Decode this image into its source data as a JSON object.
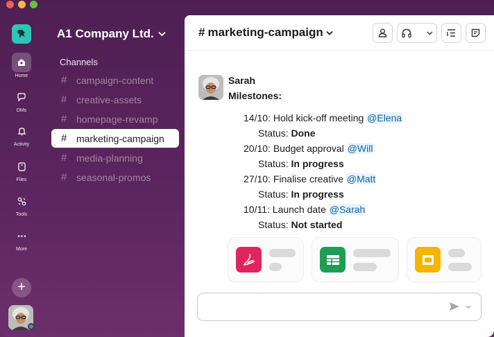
{
  "window": {
    "title": "Slack"
  },
  "rail": {
    "items": [
      {
        "label": "Home",
        "icon": "home-icon"
      },
      {
        "label": "DMs",
        "icon": "dms-icon"
      },
      {
        "label": "Activity",
        "icon": "bell-icon"
      },
      {
        "label": "Files",
        "icon": "files-icon"
      },
      {
        "label": "Tools",
        "icon": "tools-icon"
      },
      {
        "label": "More",
        "icon": "more-icon"
      }
    ],
    "add_label": "+"
  },
  "sidebar": {
    "workspace": "A1 Company Ltd.",
    "section": "Channels",
    "channels": [
      "campaign-content",
      "creative-assets",
      "homepage-revamp",
      "marketing-campaign",
      "media-planning",
      "seasonal-promos"
    ],
    "active_channel_index": 3
  },
  "header": {
    "channel": "marketing-campaign",
    "hash": "#"
  },
  "message": {
    "author": "Sarah",
    "title": "Milestones:",
    "items": [
      {
        "date": "14/10:",
        "text": "Hold kick-off meeting",
        "mention": "@Elena",
        "status_label": "Status:",
        "status": "Done"
      },
      {
        "date": "20/10:",
        "text": "Budget approval",
        "mention": "@Will",
        "status_label": "Status:",
        "status": "In progress"
      },
      {
        "date": "27/10:",
        "text": "Finalise creative",
        "mention": "@Matt",
        "status_label": "Status:",
        "status": "In progress"
      },
      {
        "date": "10/11:",
        "text": "Launch date",
        "mention": "@Sarah",
        "status_label": "Status:",
        "status": "Not started"
      }
    ]
  },
  "attachments": [
    {
      "type": "pdf",
      "icon": "pdf-icon",
      "color": "#e0245e"
    },
    {
      "type": "spreadsheet",
      "icon": "sheets-icon",
      "color": "#1e9e55"
    },
    {
      "type": "slides",
      "icon": "slides-icon",
      "color": "#f4b400"
    }
  ],
  "colors": {
    "accent": "#5c2660",
    "mention": "#1264a3"
  }
}
